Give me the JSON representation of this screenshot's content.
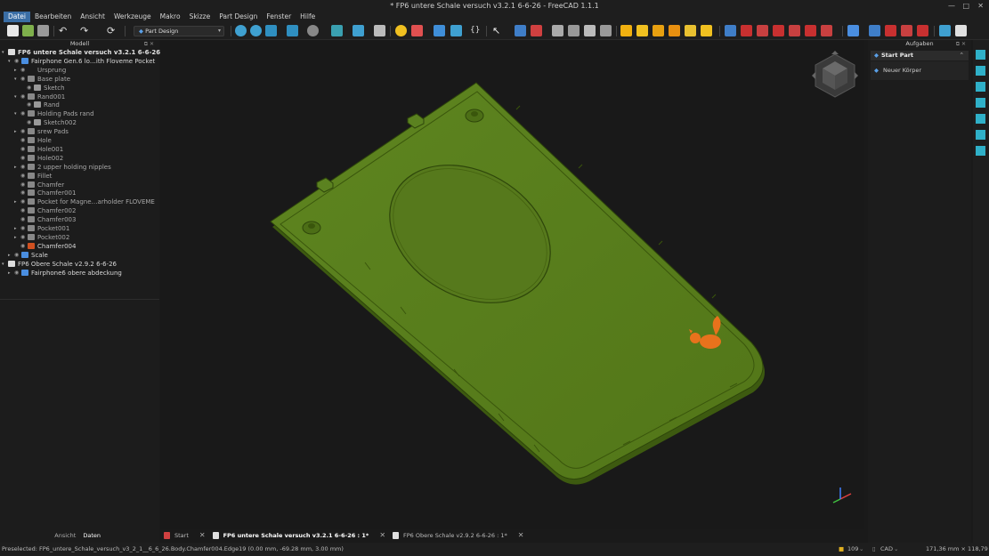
{
  "window": {
    "title": "* FP6 untere Schale versuch v3.2.1  6-6-26 - FreeCAD 1.1.1",
    "minimize": "—",
    "maximize": "□",
    "close": "✕"
  },
  "menu": [
    "Datei",
    "Bearbeiten",
    "Ansicht",
    "Werkzeuge",
    "Makro",
    "Skizze",
    "Part Design",
    "Fenster",
    "Hilfe"
  ],
  "toolbar": {
    "workbench": "Part Design"
  },
  "tree": {
    "title": "Modell",
    "rows": [
      {
        "label": "FP6 untere Schale versuch v3.2.1  6-6-26"
      },
      {
        "label": "Fairphone Gen.6 lo…ith Floveme Pocket"
      },
      {
        "label": "Ursprung"
      },
      {
        "label": "Base plate"
      },
      {
        "label": "Sketch"
      },
      {
        "label": "Rand001"
      },
      {
        "label": "Rand"
      },
      {
        "label": "Holding Pads rand"
      },
      {
        "label": "Sketch002"
      },
      {
        "label": "srew Pads"
      },
      {
        "label": "Hole"
      },
      {
        "label": "Hole001"
      },
      {
        "label": "Hole002"
      },
      {
        "label": "2 upper holding nipples"
      },
      {
        "label": "Fillet"
      },
      {
        "label": "Chamfer"
      },
      {
        "label": "Chamfer001"
      },
      {
        "label": "Pocket for Magne…arholder FLOVEME"
      },
      {
        "label": "Chamfer002"
      },
      {
        "label": "Chamfer003"
      },
      {
        "label": "Pocket001"
      },
      {
        "label": "Pocket002"
      },
      {
        "label": "Chamfer004"
      },
      {
        "label": "Scale"
      },
      {
        "label": "FP6 Obere Schale v2.9.2 6-6-26"
      },
      {
        "label": "Fairphone6 obere abdeckung"
      }
    ]
  },
  "panel_tabs": [
    "Ansicht",
    "Daten"
  ],
  "tasks": {
    "title": "Aufgaben",
    "start_part": "Start Part",
    "new_body": "Neuer Körper"
  },
  "doc_tabs": [
    "Start",
    "FP6 untere Schale versuch v3.2.1  6-6-26 : 1*",
    "FP6 Obere Schale v2.9.2 6-6-26 : 1*"
  ],
  "status": {
    "preselected": "Preselected: FP6_untere_Schale_versuch_v3_2_1__6_6_26.Body.Chamfer004.Edge19 (0.00 mm, -69.28 mm, 3.00 mm)",
    "zoom": "109",
    "nav": "CAD",
    "dims": "171,36 mm × 118,79 mm"
  },
  "colors": {
    "model_green": "#5a7f1a",
    "accent": "#3a6ea5",
    "squirrel": "#e8721c"
  }
}
